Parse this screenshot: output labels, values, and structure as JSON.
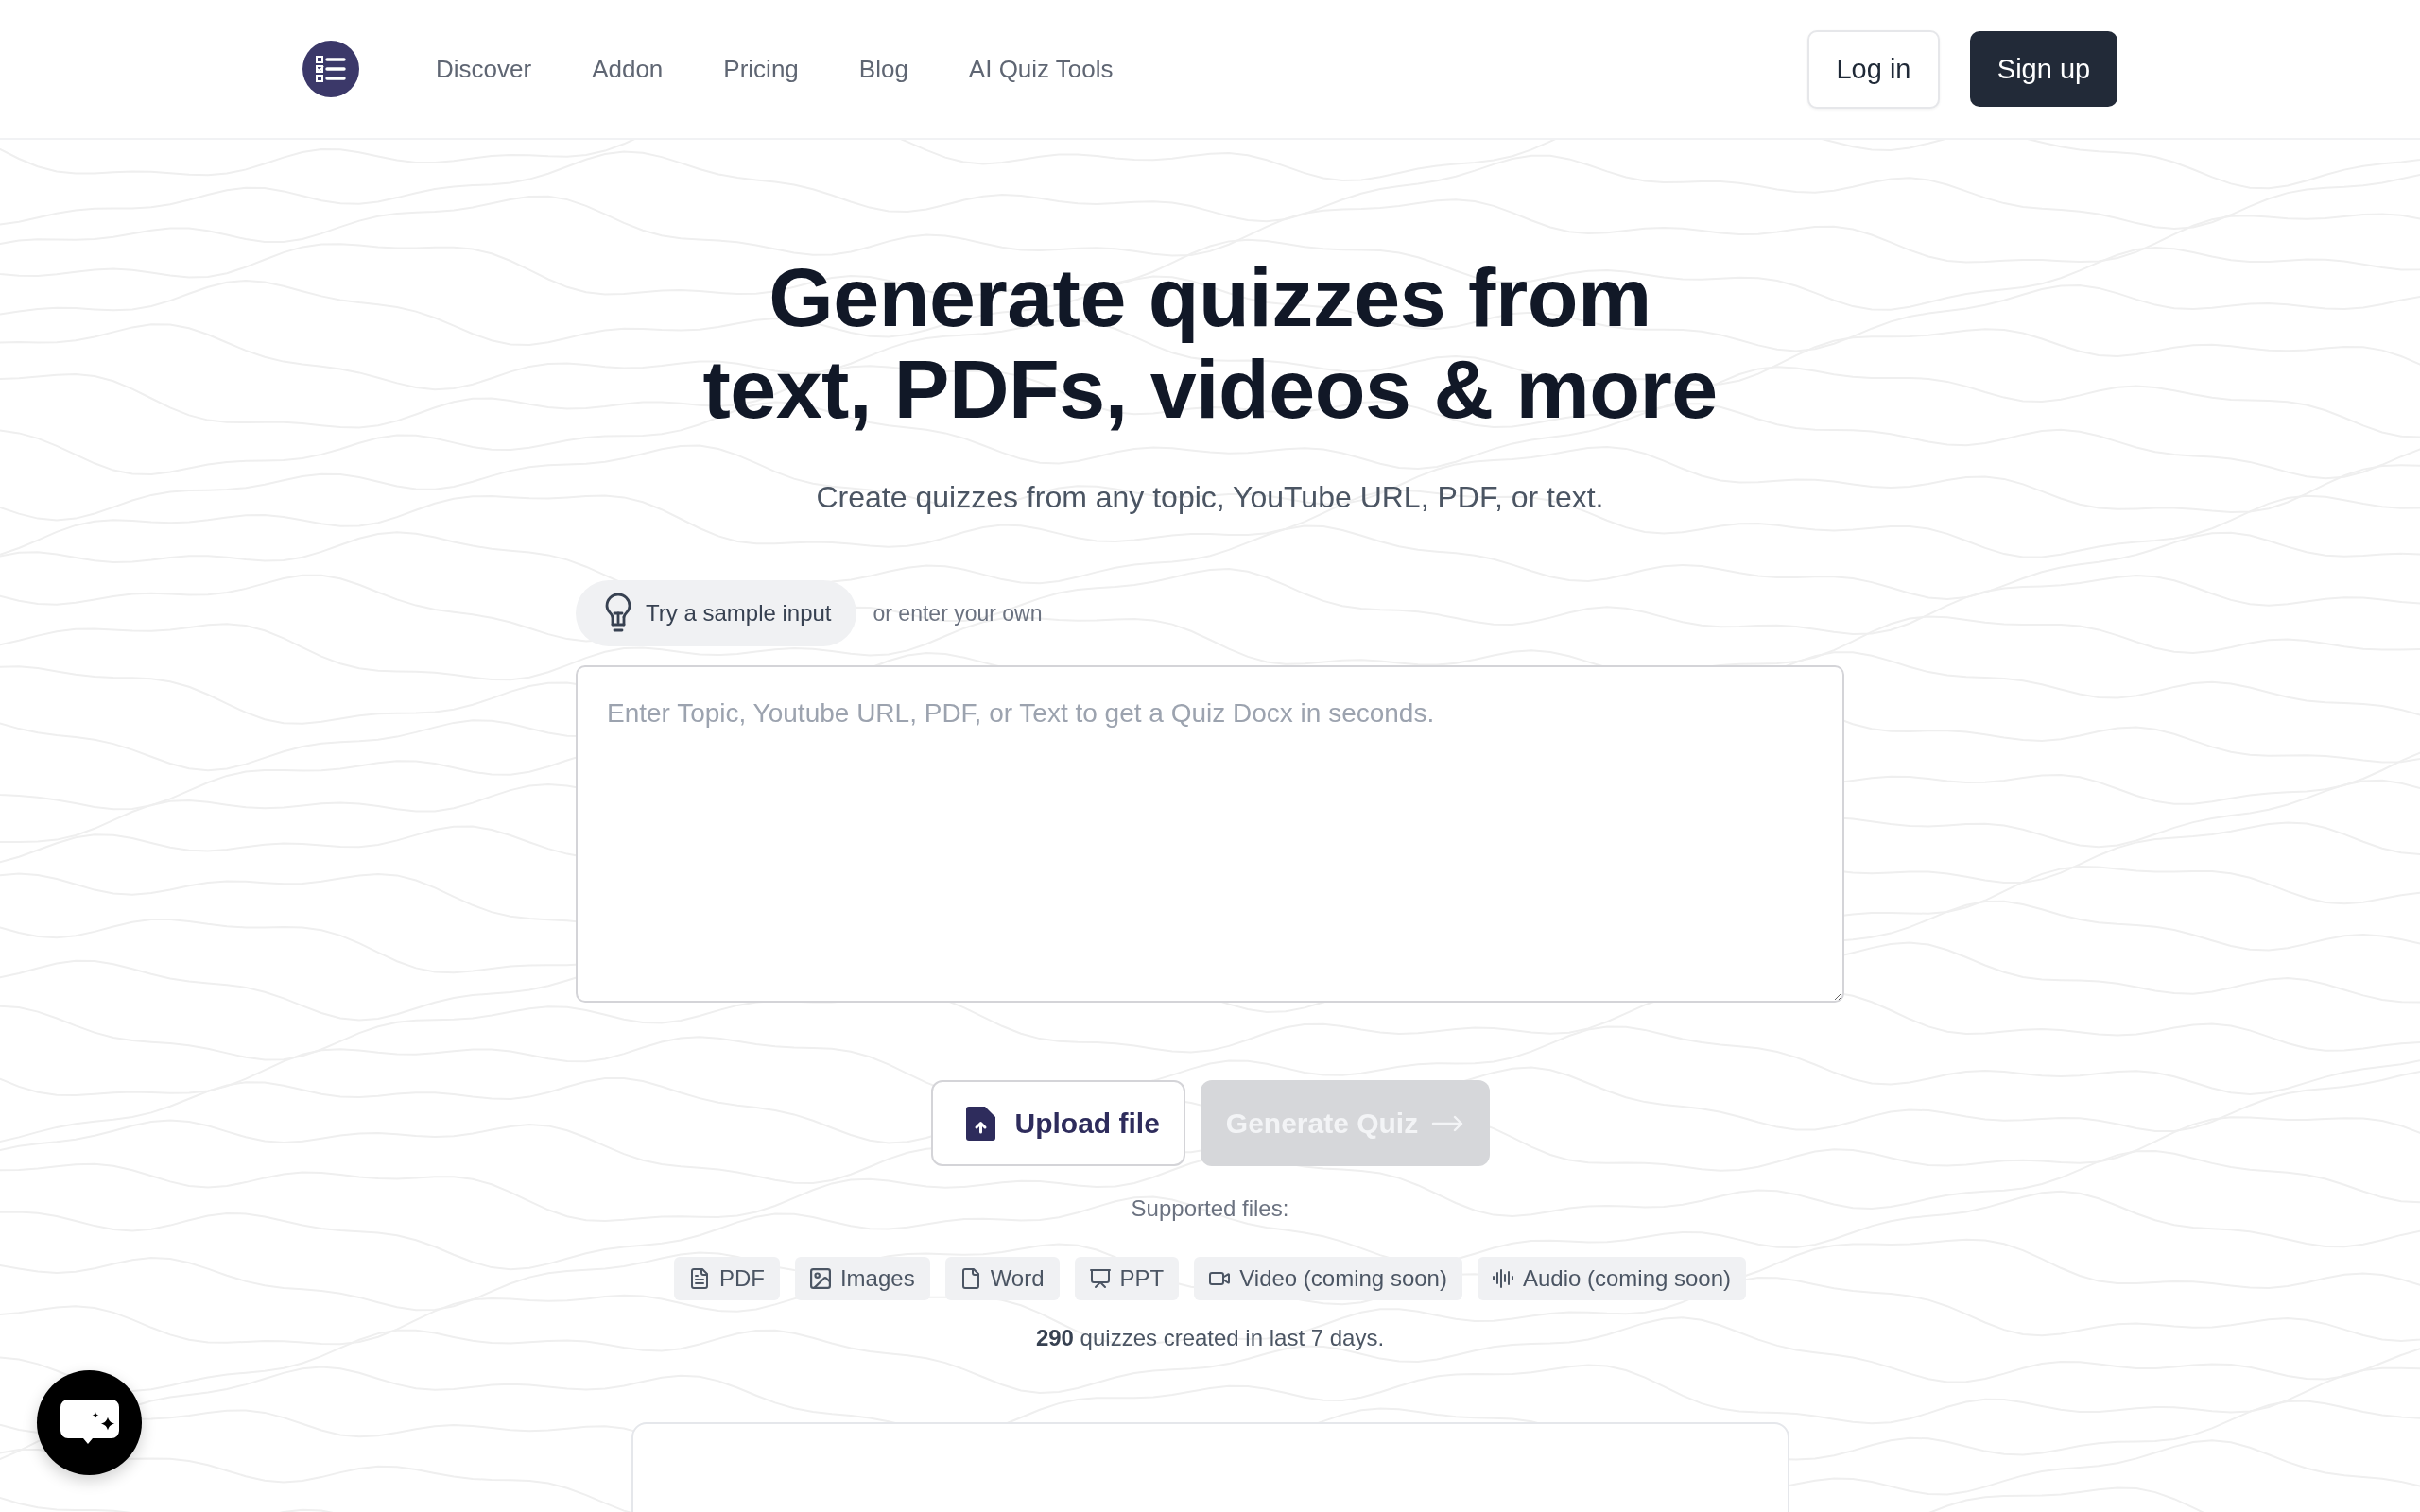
{
  "header": {
    "nav": [
      "Discover",
      "Addon",
      "Pricing",
      "Blog",
      "AI Quiz Tools"
    ],
    "login_button": "Log in",
    "signup_button": "Sign up"
  },
  "hero": {
    "title_lines": [
      "Generate quizzes from",
      "text, PDFs, videos & more"
    ],
    "subtitle": "Create quizzes from any topic, YouTube URL, PDF, or text."
  },
  "sample": {
    "button": "Try a sample input",
    "hint": "or enter your own"
  },
  "input": {
    "placeholder": "Enter Topic, Youtube URL, PDF, or Text to get a Quiz Docx in seconds."
  },
  "actions": {
    "upload": {
      "label": "Upload file"
    },
    "generate": {
      "label": "Generate Quiz",
      "disabled": true
    }
  },
  "supported": {
    "label": "Supported files:",
    "file_types": [
      {
        "kind": "pdf",
        "label": "PDF"
      },
      {
        "kind": "image",
        "label": "Images"
      },
      {
        "kind": "word",
        "label": "Word"
      },
      {
        "kind": "ppt",
        "label": "PPT"
      },
      {
        "kind": "video",
        "label": "Video (coming soon)"
      },
      {
        "kind": "audio",
        "label": "Audio (coming soon)"
      }
    ]
  },
  "stats": "**290** quizzes created in last 7 days."
}
